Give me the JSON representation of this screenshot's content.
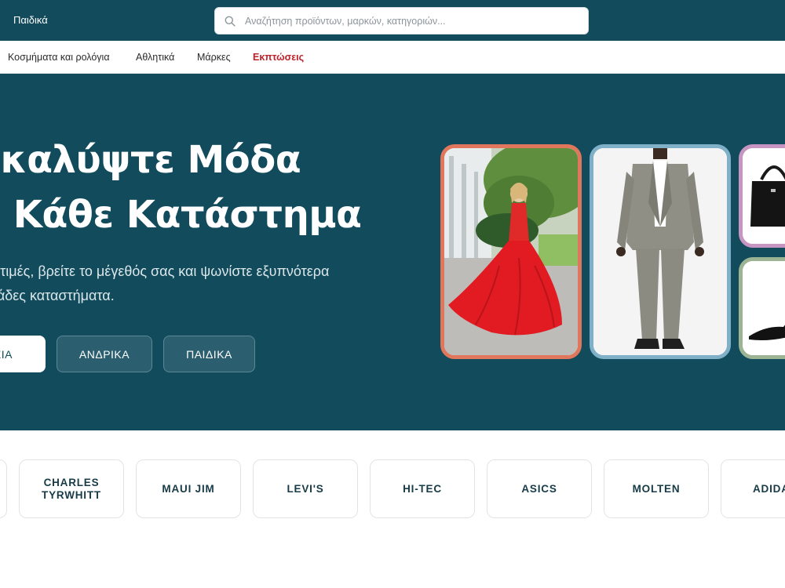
{
  "header": {
    "nav_label": "Παιδικά",
    "search_placeholder": "Αναζήτηση προϊόντων, μαρκών, κατηγοριών..."
  },
  "category_nav": [
    {
      "label": "Κοσμήματα και ρολόγια"
    },
    {
      "label": "Αθλητικά"
    },
    {
      "label": "Μάρκες"
    },
    {
      "label": "Εκπτώσεις"
    }
  ],
  "hero": {
    "title_line1": "ακαλύψτε Μόδα",
    "title_line2": "ό Κάθε Κατάστημα",
    "subtitle_line1": "τε τιμές, βρείτε το μέγεθός σας και ψωνίστε εξυπνότερα",
    "subtitle_line2": "ντάδες καταστήματα.",
    "buttons": [
      {
        "label": "ΚΕΙΑ"
      },
      {
        "label": "ΑΝΔΡΙΚΑ"
      },
      {
        "label": "ΠΑΙΔΙΚΑ"
      }
    ]
  },
  "brands": [
    {
      "label": "CHARLES TYRWHITT"
    },
    {
      "label": "MAUI JIM"
    },
    {
      "label": "LEVI'S"
    },
    {
      "label": "HI-TEC"
    },
    {
      "label": "ASICS"
    },
    {
      "label": "MOLTEN"
    },
    {
      "label": "ADIDAS"
    }
  ],
  "colors": {
    "brand_teal": "#114b5c",
    "sale_red": "#c0202a",
    "dress_frame": "#e0765c",
    "suit_frame": "#7fb0c8",
    "bag_frame": "#c795c2",
    "shoe_frame": "#9cb493"
  },
  "icons": {
    "search": "search-icon"
  }
}
